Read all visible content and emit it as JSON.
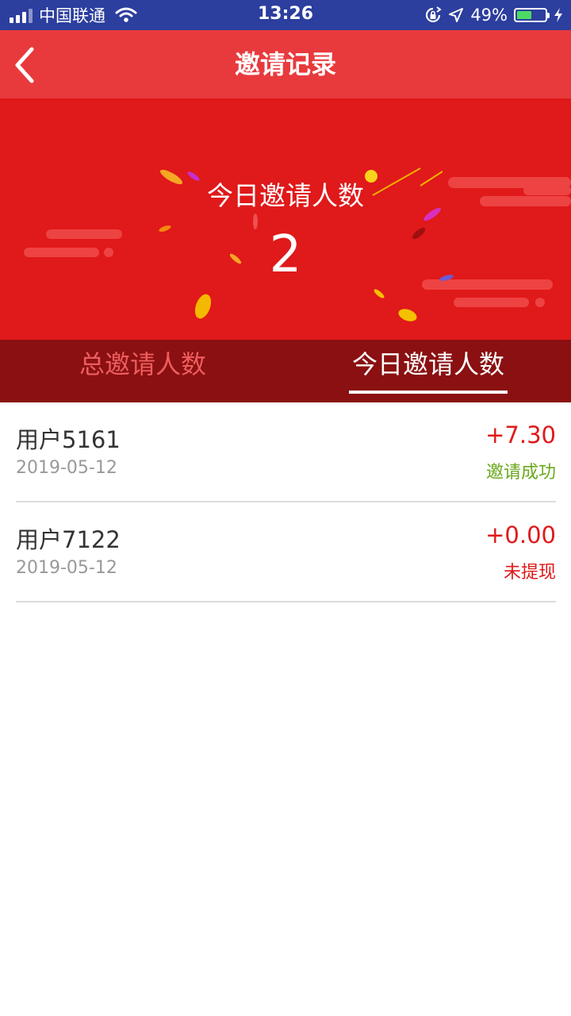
{
  "status_bar": {
    "carrier": "中国联通",
    "time": "13:26",
    "battery_percent": "49%",
    "icons": [
      "signal-icon",
      "wifi-icon",
      "orientation-lock-icon",
      "location-icon",
      "battery-icon",
      "charging-icon"
    ]
  },
  "nav": {
    "title": "邀请记录",
    "back_icon": "chevron-left-icon"
  },
  "banner": {
    "label": "今日邀请人数",
    "count": "2"
  },
  "tabs": [
    {
      "label": "总邀请人数",
      "active": false
    },
    {
      "label": "今日邀请人数",
      "active": true
    }
  ],
  "records": [
    {
      "user": "用户5161",
      "date": "2019-05-12",
      "amount": "+7.30",
      "status": "邀请成功",
      "status_color": "#6aa81c"
    },
    {
      "user": "用户7122",
      "date": "2019-05-12",
      "amount": "+0.00",
      "status": "未提现",
      "status_color": "#e0191a"
    }
  ],
  "colors": {
    "status_bar": "#2c3e9e",
    "nav_bar": "#e83a3d",
    "banner": "#e0191a",
    "tab_bar": "#8a1011",
    "accent": "#e0191a"
  }
}
